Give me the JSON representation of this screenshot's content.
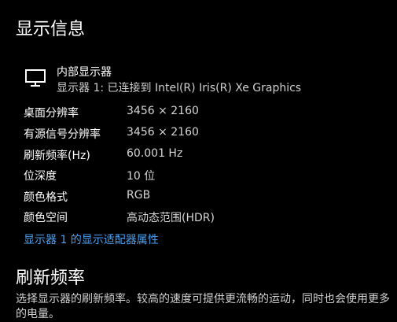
{
  "display_info": {
    "title": "显示信息",
    "display_name": "内部显示器",
    "display_subtitle": "显示器 1: 已连接到 Intel(R) Iris(R) Xe Graphics",
    "rows": [
      {
        "label": "桌面分辨率",
        "value": "3456 × 2160"
      },
      {
        "label": "有源信号分辨率",
        "value": "3456 × 2160"
      },
      {
        "label": "刷新频率(Hz)",
        "value": "60.001 Hz"
      },
      {
        "label": "位深度",
        "value": "10 位"
      },
      {
        "label": "颜色格式",
        "value": "RGB"
      },
      {
        "label": "颜色空间",
        "value": "高动态范围(HDR)"
      }
    ],
    "adapter_link": "显示器 1 的显示适配器属性"
  },
  "refresh_rate": {
    "title": "刷新频率",
    "description": "选择显示器的刷新频率。较高的速度可提供更流畅的运动，同时也会使用更多的电量。"
  },
  "icons": {
    "monitor": "monitor-icon"
  },
  "colors": {
    "background": "#000000",
    "text": "#ffffff",
    "secondary_text": "#d6d6d6",
    "link": "#4aa0f0"
  }
}
